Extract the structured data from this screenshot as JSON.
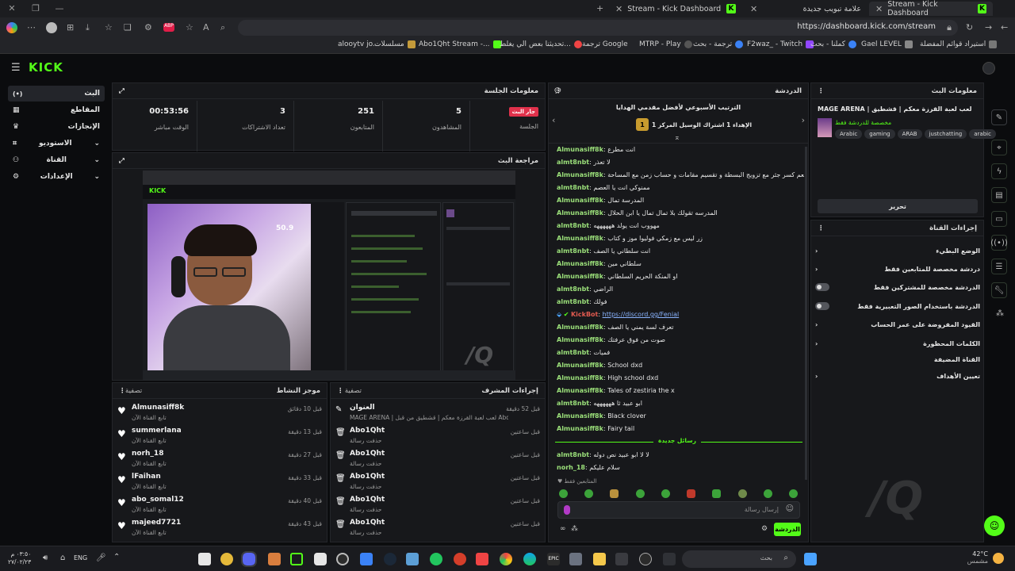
{
  "browser": {
    "tabs": [
      {
        "title": "Stream - Kick Dashboard",
        "active": false
      },
      {
        "title": "علامة تبويب جديدة",
        "active": false
      },
      {
        "title": "Stream - Kick Dashboard",
        "active": true
      }
    ],
    "url": "https://dashboard.kick.com/stream",
    "bookmarks": [
      "alooytv jo...",
      "مسلسلات",
      "Abo1Qht Stream -...",
      "تحديثنا بعض الي يغلط...",
      "ترجمة Google",
      "MTRP - Play",
      "ترجمة - بحث",
      "F2waz_ - Twitch",
      "كملنا - بحث",
      "Gael LEVEL",
      "استيراد قوائم المفضلة"
    ]
  },
  "brand": {
    "logo": "KICK",
    "accent": "#53fc18"
  },
  "sidebar": {
    "items": [
      {
        "label": "البث",
        "icon": "live-icon"
      },
      {
        "label": "المقاطع",
        "icon": "clips-icon"
      },
      {
        "label": "الإنجازات",
        "icon": "achievements-icon"
      },
      {
        "label": "الاستوديو",
        "icon": "studio-icon"
      },
      {
        "label": "القناة",
        "icon": "channel-icon"
      },
      {
        "label": "الإعدادات",
        "icon": "settings-icon"
      }
    ]
  },
  "session": {
    "title": "معلومات الجلسة",
    "live_badge": "جار البث",
    "session_label": "الجلسة",
    "stats": [
      {
        "value": "5",
        "label": "المشاهدون"
      },
      {
        "value": "251",
        "label": "المتابعون"
      },
      {
        "value": "3",
        "label": "تعداد الاشتراكات"
      },
      {
        "value": "00:53:56",
        "label": "الوقت مباشر"
      }
    ]
  },
  "preview": {
    "title": "مراجعة البث",
    "overlay_number": "50.9"
  },
  "activity": {
    "title": "موجز النشاط",
    "filter": "تصفية",
    "items": [
      {
        "name": "Almunasiff8k",
        "sub": "تابع القناة الآن",
        "time": "قبل 10 دقائق"
      },
      {
        "name": "summerlana",
        "sub": "تابع القناة الآن",
        "time": "قبل 13 دقيقة"
      },
      {
        "name": "norh_18",
        "sub": "تابع القناة الآن",
        "time": "قبل 27 دقيقة"
      },
      {
        "name": "lFaihan",
        "sub": "تابع القناة الآن",
        "time": "قبل 33 دقيقة"
      },
      {
        "name": "abo_somal12",
        "sub": "تابع القناة الآن",
        "time": "قبل 40 دقيقة"
      },
      {
        "name": "majeed7721",
        "sub": "تابع القناة الآن",
        "time": "قبل 43 دقيقة"
      }
    ]
  },
  "modactions": {
    "title": "إجراءات المشرف",
    "filter": "تصفية",
    "items": [
      {
        "name": "العنوان",
        "sub": "MAGE ARENA | لعب لعبة القرزة معكم | قشطيق من قبل Abo1Qht تم تغييره إلى",
        "time": "قبل 52 دقيقة"
      },
      {
        "name": "Abo1Qht",
        "sub": "حذفت رسالة",
        "time": "قبل ساعتين"
      },
      {
        "name": "Abo1Qht",
        "sub": "حذفت رسالة",
        "time": "قبل ساعتين"
      },
      {
        "name": "Abo1Qht",
        "sub": "حذفت رسالة",
        "time": "قبل ساعتين"
      },
      {
        "name": "Abo1Qht",
        "sub": "حذفت رسالة",
        "time": "قبل ساعتين"
      },
      {
        "name": "Abo1Qht",
        "sub": "حذفت رسالة",
        "time": "قبل ساعتين"
      }
    ]
  },
  "chat": {
    "title": "الدردشة",
    "pinned_title": "الترتيب الأسبوعي لأفضل مقدمي الهدايا",
    "pinned_sub": "الإهداء 1 اشتراك الوسيل المركز 1",
    "pinned_rank": "1",
    "messages": [
      {
        "user": "Almunasiff8k",
        "text": "انت مطرع"
      },
      {
        "user": "almt8nbt",
        "text": "لا تعذر"
      },
      {
        "user": "Almunasiff8k",
        "text": "وجبة بطعم كسر جثر مع تزويج البسطة و تقسيم مقامات و حساب زمن مع المساحة"
      },
      {
        "user": "almt8nbt",
        "text": "ممنوكي انت يا العصم"
      },
      {
        "user": "Almunasiff8k",
        "text": "المدرسة تمال"
      },
      {
        "user": "Almunasiff8k",
        "text": "المدرسه تقولك بلا تمال تمال يا ابن الحلال"
      },
      {
        "user": "almt8nbt",
        "text": "مهووب انت يولد ههههههه"
      },
      {
        "user": "Almunasiff8k",
        "text": "زر ليس مع زمكي فوليوا موز و كتاب"
      },
      {
        "user": "almt8nbt",
        "text": "انت سلطاني يا الصف"
      },
      {
        "user": "Almunasiff8k",
        "text": "سلطاني مين"
      },
      {
        "user": "Almunasiff8k",
        "text": "او المنكة الحريم السلطاني"
      },
      {
        "user": "almt8nbt",
        "text": "الراضي"
      },
      {
        "user": "almt8nbt",
        "text": "فولك"
      },
      {
        "user": "KickBot",
        "text": "https://discord.gg/Fenial",
        "bot": true
      },
      {
        "user": "Almunasiff8k",
        "text": "تعرف لسة يمني يا الصف"
      },
      {
        "user": "Almunasiff8k",
        "text": "صوت من فوق عرفتك"
      },
      {
        "user": "almt8nbt",
        "text": "فميات"
      },
      {
        "user": "Almunasiff8k",
        "text": "School dxd"
      },
      {
        "user": "Almunasiff8k",
        "text": "High school dxd"
      },
      {
        "user": "Almunasiff8k",
        "text": "Tales of zestiria the x"
      },
      {
        "user": "almt8nbt",
        "text": "ابو عبيد ثا ههههههه"
      },
      {
        "user": "Almunasiff8k",
        "text": "Black clover"
      },
      {
        "user": "Almunasiff8k",
        "text": "Fairy tail"
      }
    ],
    "new_messages_label": "رسائل جديدة",
    "after_messages": [
      {
        "user": "almt8nbt",
        "text": "لا لا ابو عبيد نص دوله"
      },
      {
        "user": "norh_18",
        "text": "سلام عليكم"
      }
    ],
    "followers_only": "المتابعين فقط",
    "input_placeholder": "إرسال رسالة",
    "send_button": "الدردشة"
  },
  "streaminfo": {
    "title": "معلومات البث",
    "stream_title": "MAGE ARENA | لعب لعبة القرزة معكم | قشطيق",
    "category": "مخصصة للدردشة فقط",
    "tags": [
      "Arabic",
      "gaming",
      "ARAB",
      "justchatting",
      "arabic"
    ],
    "edit_button": "تحرير"
  },
  "channelactions": {
    "title": "إجراءات القناة",
    "rows": [
      {
        "label": "الوضع البطيء",
        "type": "chevron"
      },
      {
        "label": "دردشة مخصصة للمتابعين فقط",
        "type": "chevron"
      },
      {
        "label": "الدردشة مخصصة للمشتركين فقط",
        "type": "toggle"
      },
      {
        "label": "الدردشة باستخدام الصور التعبيرية فقط",
        "type": "toggle"
      },
      {
        "label": "القيود المفروضة على عمر الحساب",
        "type": "chevron"
      },
      {
        "label": "الكلمات المحظورة",
        "type": "chevron"
      }
    ],
    "section_label": "القناة المضيفة",
    "host_row": "تعيين الأهداف"
  },
  "taskbar": {
    "time": "٠٣:٥٠ م",
    "date": "٢٧/٠٢/٢٣",
    "lang": "ENG",
    "search_placeholder": "بحث",
    "weather_temp": "42°C",
    "weather_desc": "مشمس"
  }
}
